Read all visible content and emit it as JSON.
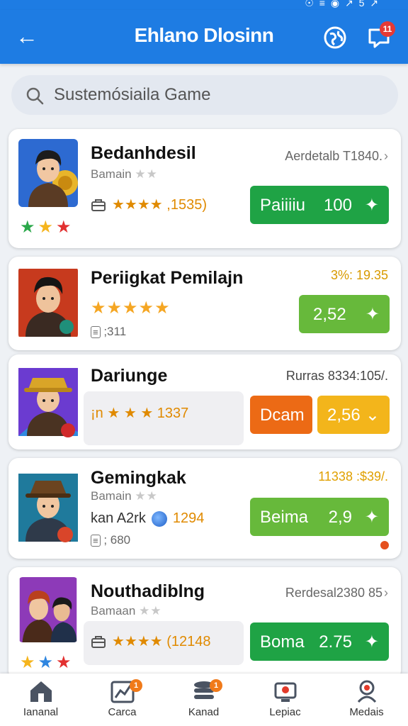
{
  "statusbar": {
    "text": "☉ ≡ ◉ ↗ 5 ↗"
  },
  "appbar": {
    "title": "Ehlano Dlosinn",
    "notif_count": "11"
  },
  "search": {
    "placeholder": "Sustemósiaila Game"
  },
  "cards": [
    {
      "name": "Bedanhdesil",
      "sub": "Bamain",
      "right": "Aerdetalb T1840.",
      "stat": "★★★★ ,1535)",
      "btn_label": "Paiiiiu",
      "btn_value": "100",
      "btn_icon": "✦"
    },
    {
      "name": "Periigkat Pemilajn",
      "right": "3%: 19.35",
      "stars": "★★★★★",
      "meta": ";311",
      "btn_value": "2,52",
      "btn_icon": "✦"
    },
    {
      "name": "Dariunge",
      "right": "Rurras 8334:105/.",
      "stat": "¡n ★ ★ ★ 1337",
      "btn1_label": "Dcam",
      "btn2_value": "2,56",
      "btn2_icon": "⌄"
    },
    {
      "name": "Gemingkak",
      "sub": "Bamain",
      "right": "11338 :$39/.",
      "stat_prefix": "kan A2rk",
      "stat_value": "1294",
      "meta": "; 680",
      "btn_label": "Beima",
      "btn_value": "2,9",
      "btn_icon": "✦"
    },
    {
      "name": "Nouthadiblng",
      "sub": "Bamaan",
      "right": "Rerdesal2380 85",
      "stat": "★★★★ (12148",
      "btn_label": "Boma",
      "btn_value": "2.75",
      "btn_icon": "✦"
    }
  ],
  "nav": [
    {
      "label": "Iananal",
      "icon": "home-icon"
    },
    {
      "label": "Carca",
      "icon": "chart-icon",
      "badge": "1"
    },
    {
      "label": "Kanad",
      "icon": "stack-icon",
      "badge": "1"
    },
    {
      "label": "Lepiac",
      "icon": "trophy-icon"
    },
    {
      "label": "Medais",
      "icon": "medal-icon"
    }
  ],
  "colors": {
    "appbar": "#1e7ce3",
    "green_dark": "#1fa345",
    "green_light": "#67b93b",
    "orange": "#ec6a15",
    "amber": "#f3b51b"
  }
}
